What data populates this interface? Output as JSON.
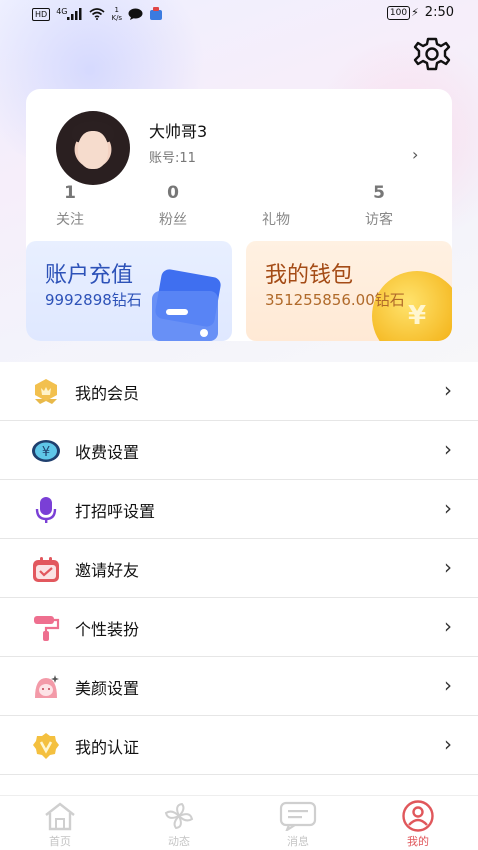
{
  "status_bar": {
    "hd": "HD",
    "network": "4G",
    "speed_value": "1",
    "speed_unit": "K/s",
    "battery": "100",
    "time": "2:50"
  },
  "profile": {
    "name": "大帅哥3",
    "account": "账号:11",
    "stats": [
      {
        "value": "1",
        "label": "关注"
      },
      {
        "value": "0",
        "label": "粉丝"
      },
      {
        "value": "",
        "label": "礼物"
      },
      {
        "value": "5",
        "label": "访客"
      }
    ]
  },
  "promos": {
    "recharge": {
      "title": "账户充值",
      "subtitle": "9992898钻石"
    },
    "wallet": {
      "title": "我的钱包",
      "subtitle": "351255856.00钻石"
    }
  },
  "menu": [
    {
      "label": "我的会员",
      "icon": "vip-badge-icon"
    },
    {
      "label": "收费设置",
      "icon": "yen-coin-icon"
    },
    {
      "label": "打招呼设置",
      "icon": "microphone-icon"
    },
    {
      "label": "邀请好友",
      "icon": "invite-calendar-icon"
    },
    {
      "label": "个性装扮",
      "icon": "paint-roller-icon"
    },
    {
      "label": "美颜设置",
      "icon": "beauty-face-icon"
    },
    {
      "label": "我的认证",
      "icon": "verified-badge-icon"
    }
  ],
  "bottom_nav": [
    {
      "label": "首页",
      "icon": "home-icon",
      "active": false
    },
    {
      "label": "动态",
      "icon": "pinwheel-icon",
      "active": false
    },
    {
      "label": "消息",
      "icon": "message-icon",
      "active": false
    },
    {
      "label": "我的",
      "icon": "profile-icon",
      "active": true
    }
  ],
  "colors": {
    "accent": "#e0575b",
    "recharge_text": "#2d52b8",
    "wallet_text": "#a44b16",
    "coin": "#f4b51c"
  }
}
